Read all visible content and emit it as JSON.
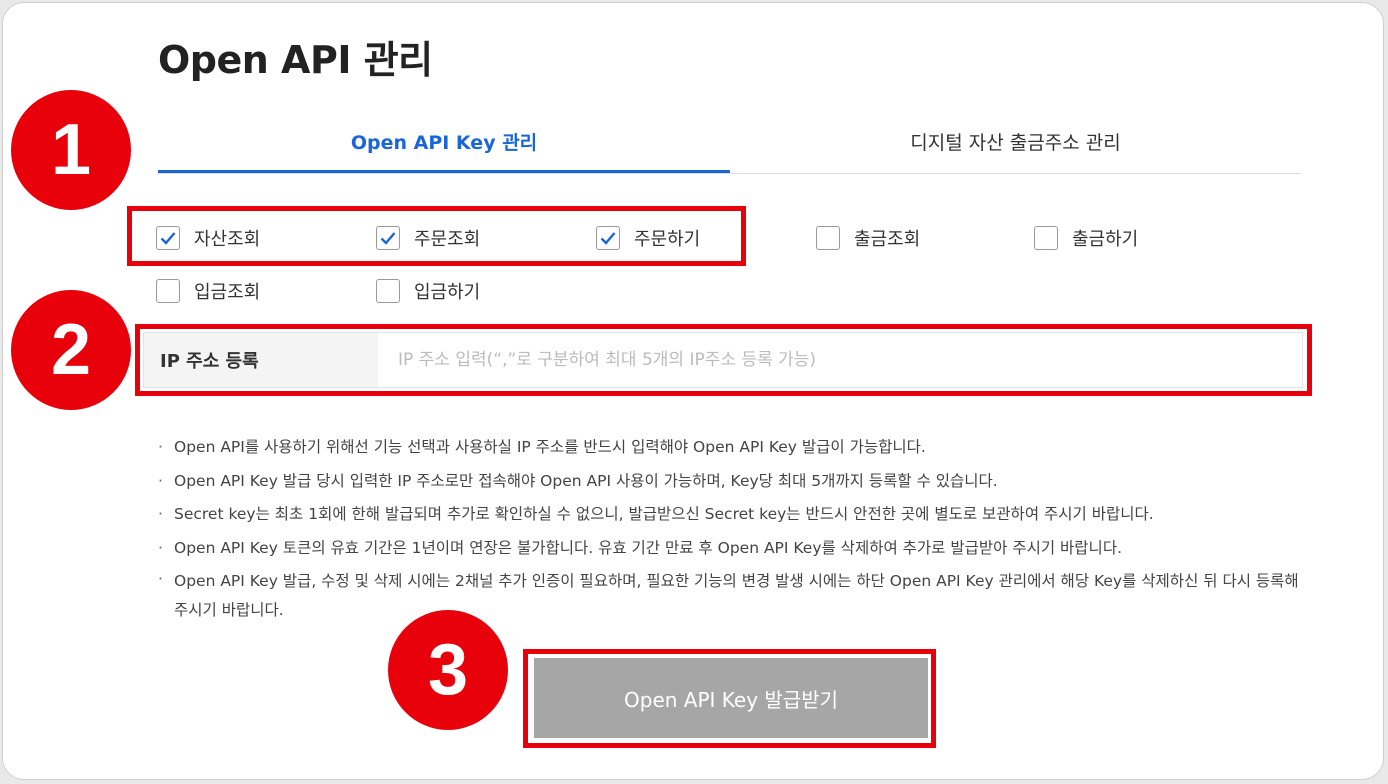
{
  "page": {
    "title": "Open API 관리"
  },
  "tabs": [
    {
      "label": "Open API Key 관리",
      "active": true
    },
    {
      "label": "디지털 자산 출금주소 관리",
      "active": false
    }
  ],
  "permissions": [
    {
      "label": "자산조회",
      "checked": true
    },
    {
      "label": "주문조회",
      "checked": true
    },
    {
      "label": "주문하기",
      "checked": true
    },
    {
      "label": "출금조회",
      "checked": false
    },
    {
      "label": "출금하기",
      "checked": false
    },
    {
      "label": "입금조회",
      "checked": false
    },
    {
      "label": "입금하기",
      "checked": false
    }
  ],
  "ip": {
    "label": "IP 주소 등록",
    "placeholder": "IP 주소 입력(“,”로 구분하여 최대 5개의 IP주소 등록 가능)",
    "value": ""
  },
  "notes": [
    "Open API를 사용하기 위해선 기능 선택과 사용하실 IP 주소를 반드시 입력해야 Open API Key 발급이 가능합니다.",
    "Open API Key 발급 당시 입력한 IP 주소로만 접속해야 Open API 사용이 가능하며, Key당 최대 5개까지 등록할 수 있습니다.",
    "Secret key는 최초 1회에 한해 발급되며 추가로 확인하실 수 없으니, 발급받으신 Secret key는 반드시 안전한 곳에 별도로 보관하여 주시기 바랍니다.",
    "Open API Key 토큰의 유효 기간은 1년이며 연장은 불가합니다. 유효 기간 만료 후 Open API Key를 삭제하여 추가로 발급받아 주시기 바랍니다.",
    "Open API Key 발급, 수정 및 삭제 시에는 2채널 추가 인증이 필요하며, 필요한 기능의 변경 발생 시에는 하단 Open API Key 관리에서 해당 Key를 삭제하신 뒤 다시 등록해 주시기 바랍니다."
  ],
  "issue_button": {
    "label": "Open API Key 발급받기"
  },
  "step_badges": [
    "1",
    "2",
    "3"
  ],
  "colors": {
    "accent_blue": "#1a66d8",
    "highlight_red": "#e8000b",
    "button_gray": "#a6a6a6"
  }
}
